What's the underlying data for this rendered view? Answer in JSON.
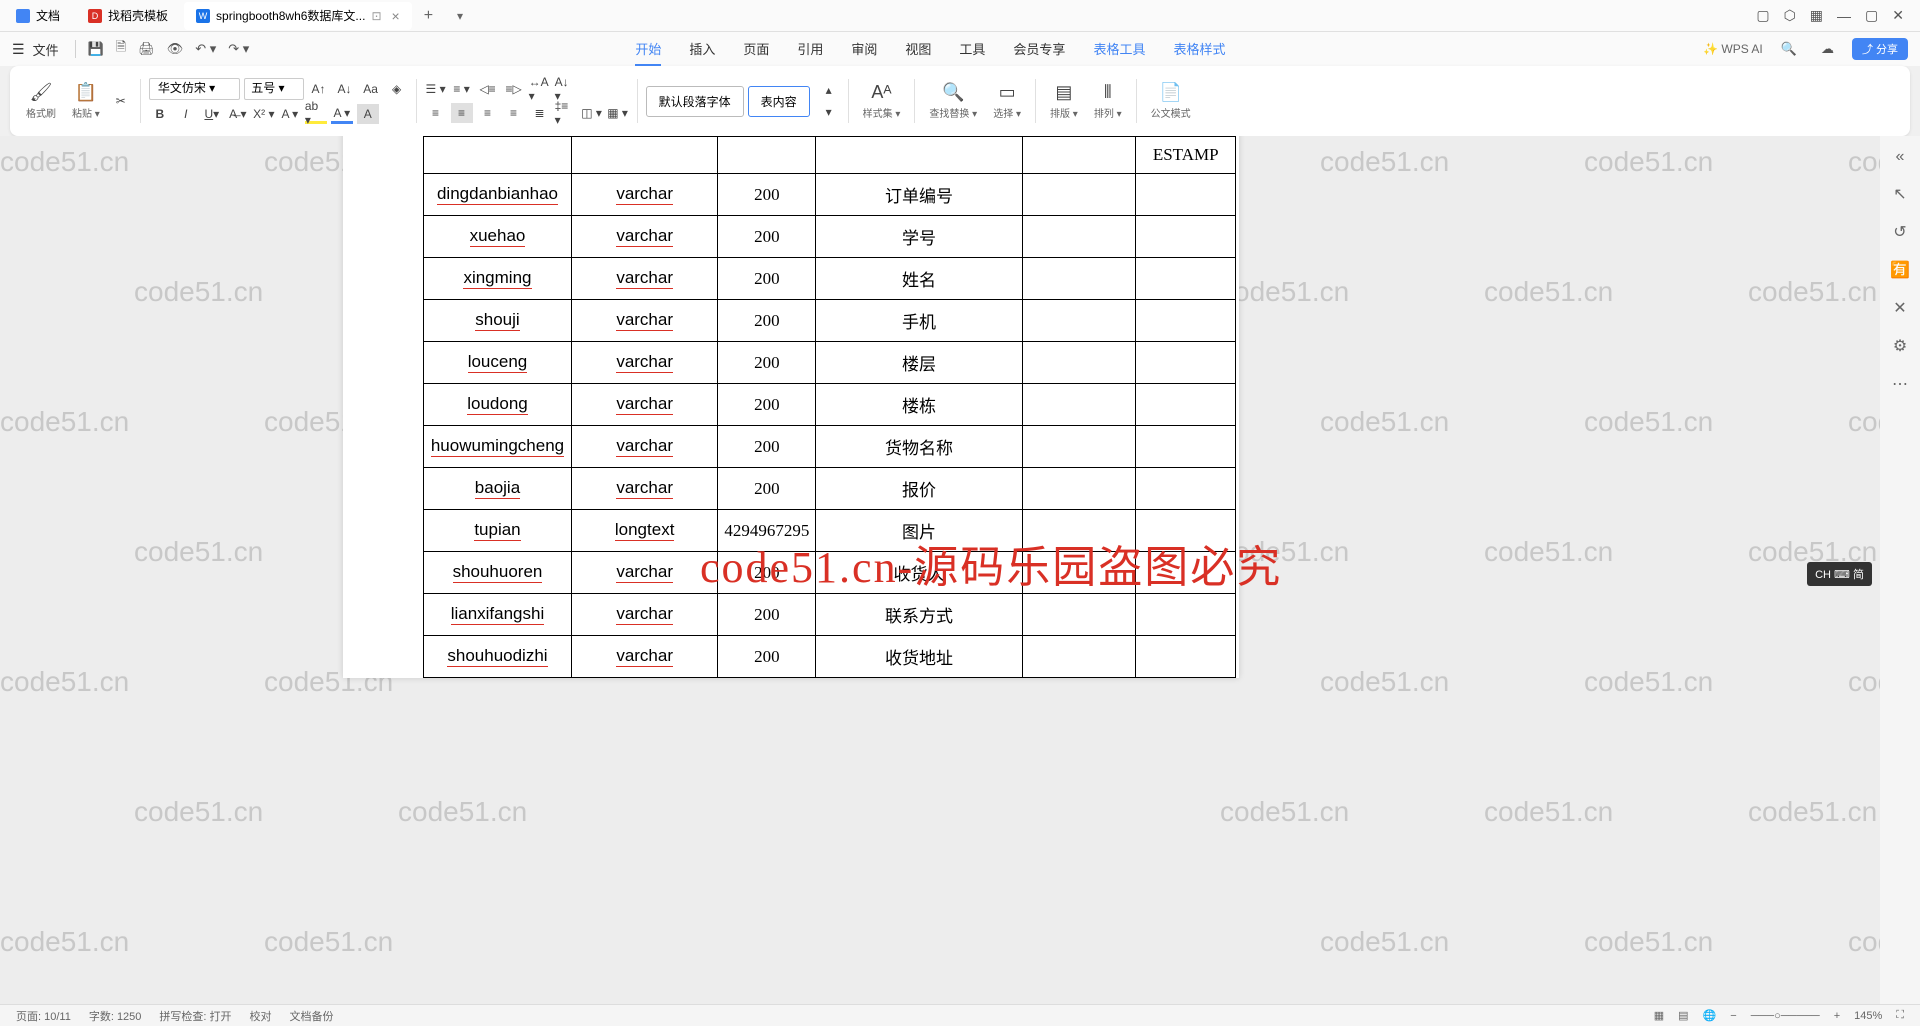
{
  "tabs": [
    {
      "label": "文档",
      "icon": "doc"
    },
    {
      "label": "找稻壳模板",
      "icon": "d"
    },
    {
      "label": "springbooth8wh6数据库文...",
      "icon": "w",
      "active": true
    }
  ],
  "menu": {
    "file": "文件",
    "items": [
      "开始",
      "插入",
      "页面",
      "引用",
      "审阅",
      "视图",
      "工具",
      "会员专享"
    ],
    "table_tools": "表格工具",
    "table_style": "表格样式",
    "wps_ai": "WPS AI",
    "share": "分享"
  },
  "ribbon": {
    "format_painter": "格式刷",
    "paste": "粘贴",
    "font_name": "华文仿宋",
    "font_size": "五号",
    "default_para_font": "默认段落字体",
    "table_content": "表内容",
    "style_set": "样式集",
    "find_replace": "查找替换",
    "select": "选择",
    "layout": "排版",
    "arrange": "排列",
    "formula_mode": "公文模式"
  },
  "table_header_partial": "ESTAMP",
  "table_rows": [
    {
      "c1": "dingdanbianhao",
      "c2": "varchar",
      "c3": "200",
      "c4": "订单编号",
      "c5": "",
      "c6": ""
    },
    {
      "c1": "xuehao",
      "c2": "varchar",
      "c3": "200",
      "c4": "学号",
      "c5": "",
      "c6": ""
    },
    {
      "c1": "xingming",
      "c2": "varchar",
      "c3": "200",
      "c4": "姓名",
      "c5": "",
      "c6": ""
    },
    {
      "c1": "shouji",
      "c2": "varchar",
      "c3": "200",
      "c4": "手机",
      "c5": "",
      "c6": ""
    },
    {
      "c1": "louceng",
      "c2": "varchar",
      "c3": "200",
      "c4": "楼层",
      "c5": "",
      "c6": ""
    },
    {
      "c1": "loudong",
      "c2": "varchar",
      "c3": "200",
      "c4": "楼栋",
      "c5": "",
      "c6": ""
    },
    {
      "c1": "huowumingcheng",
      "c2": "varchar",
      "c3": "200",
      "c4": "货物名称",
      "c5": "",
      "c6": ""
    },
    {
      "c1": "baojia",
      "c2": "varchar",
      "c3": "200",
      "c4": "报价",
      "c5": "",
      "c6": ""
    },
    {
      "c1": "tupian",
      "c2": "longtext",
      "c3": "4294967295",
      "c4": "图片",
      "c5": "",
      "c6": ""
    },
    {
      "c1": "shouhuoren",
      "c2": "varchar",
      "c3": "200",
      "c4": "收货人",
      "c5": "",
      "c6": ""
    },
    {
      "c1": "lianxifangshi",
      "c2": "varchar",
      "c3": "200",
      "c4": "联系方式",
      "c5": "",
      "c6": ""
    },
    {
      "c1": "shouhuodizhi",
      "c2": "varchar",
      "c3": "200",
      "c4": "收货地址",
      "c5": "",
      "c6": ""
    }
  ],
  "watermark_text": "code51.cn",
  "red_overlay": "code51.cn-源码乐园盗图必究",
  "ime_badge": "CH ⌨ 简",
  "status": {
    "page": "页面: 10/11",
    "words": "字数: 1250",
    "spellcheck": "拼写检查: 打开",
    "proofing": "校对",
    "backup": "文档备份",
    "zoom": "145%"
  }
}
